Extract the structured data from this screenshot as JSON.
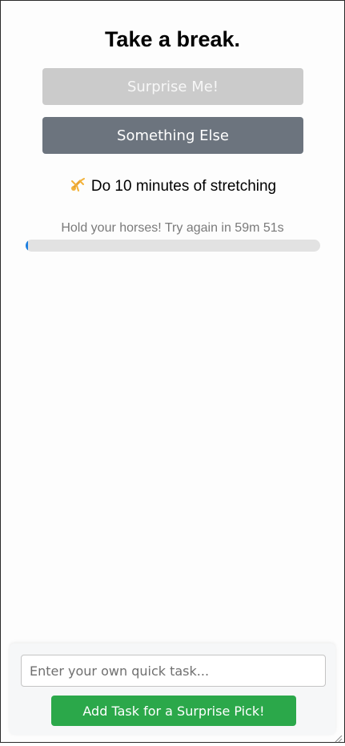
{
  "header": {
    "title": "Take a break."
  },
  "buttons": {
    "surprise_label": "Surprise Me!",
    "something_else_label": "Something Else"
  },
  "suggestion": {
    "icon": "cartwheel-person-icon",
    "text": "Do 10 minutes of stretching"
  },
  "cooldown": {
    "message": "Hold your horses! Try again in 59m 51s",
    "progress_fraction": 0.005,
    "accent_color": "#1e7fe0"
  },
  "add_task": {
    "input_value": "",
    "input_placeholder": "Enter your own quick task...",
    "button_label": "Add Task for a Surprise Pick!",
    "button_color": "#2ba84a"
  }
}
